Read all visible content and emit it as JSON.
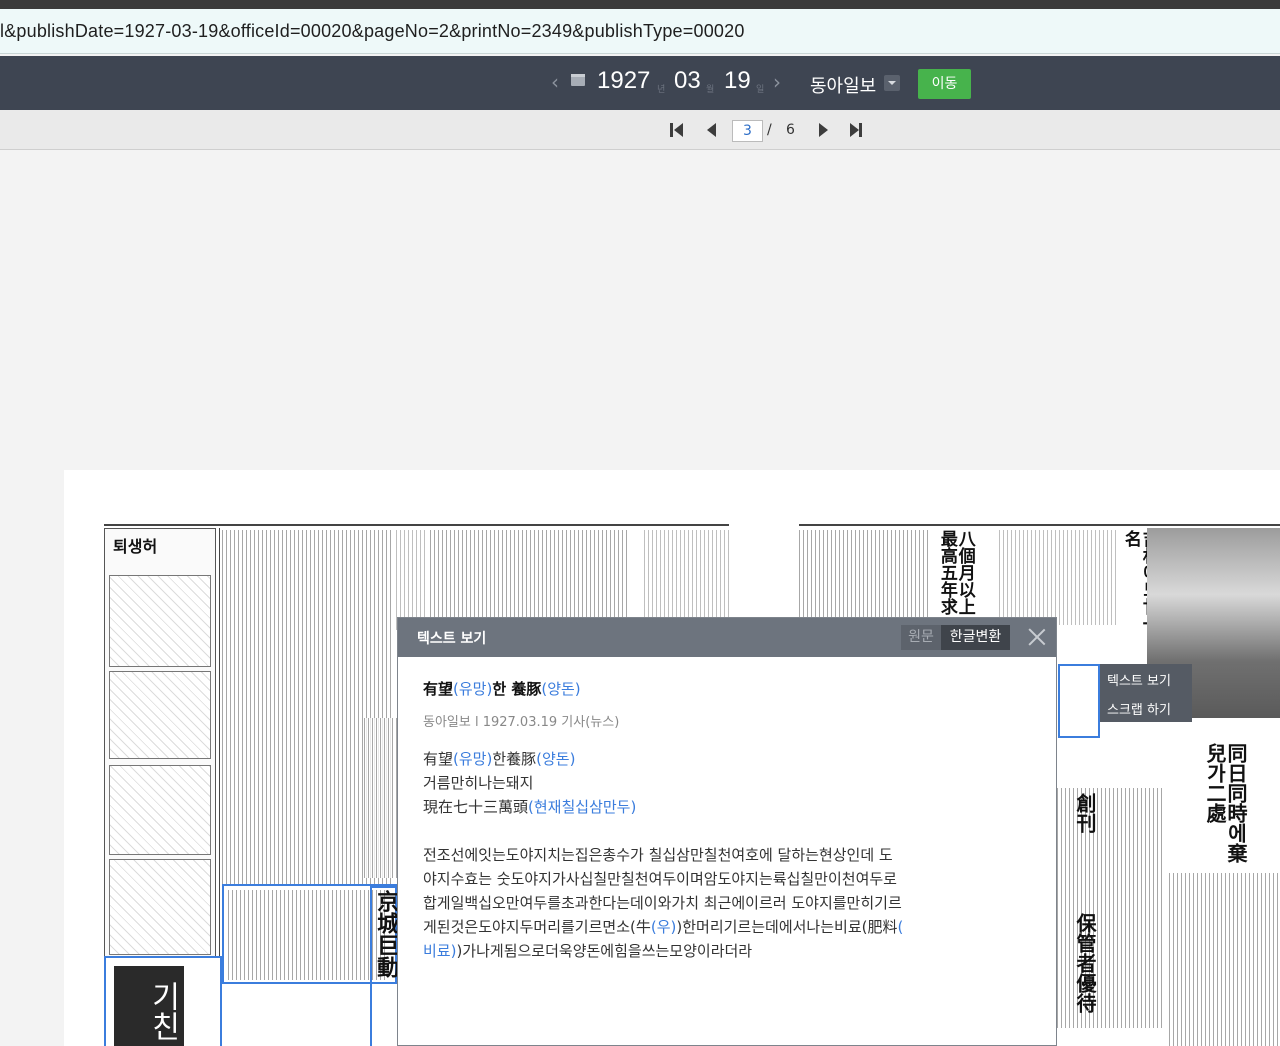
{
  "url": "l&publishDate=1927-03-19&officeId=00020&pageNo=2&printNo=2349&publishType=00020",
  "date_nav": {
    "year": "1927",
    "year_unit": "년",
    "month": "03",
    "month_unit": "월",
    "day": "19",
    "day_unit": "일",
    "newspaper": "동아일보",
    "go_label": "이동"
  },
  "page_nav": {
    "current": "3",
    "separator": "/",
    "total": "6"
  },
  "context_menu": {
    "text_view": "텍스트 보기",
    "scrap": "스크랩 하기"
  },
  "popup": {
    "header_title": "텍스트 보기",
    "tab_original": "원문",
    "tab_korean": "한글변환",
    "article_title": {
      "a": "有望",
      "a_read": "(유망)",
      "b": "한 養豚",
      "b_read": "(양돈)"
    },
    "meta": "동아일보 l 1927.03.19 기사(뉴스)",
    "lines": {
      "l1_a": "有望",
      "l1_a_read": "(유망)",
      "l1_b": "한養豚",
      "l1_b_read": "(양돈)",
      "l2": "거름만히나는돼지",
      "l3_a": "現在七十三萬頭",
      "l3_a_read": "(현재칠십삼만두)"
    },
    "paragraph": {
      "p1": " 전조선에잇는도야지치는집은총수가 칠십삼만칠천여호에 달하는현상인데 도",
      "p2": "야지수효는 숫도야지가사십칠만칠천여두이며암도야지는륙십칠만이천여두로",
      "p3": "합게일백십오만여두를초과한다는데이와가치 최근에이르러 도야지를만히기르",
      "p4_a": "게된것은도야지두머리를기르면소(牛",
      "p4_a_read": "(우)",
      "p4_b": ")한머리기르는데에서나는비료(肥料",
      "p4_b_read": "(",
      "p5_a_read": "비료)",
      "p5_b": ")가나게됨으로더욱양돈에힘을쓰는모양이라더라"
    }
  },
  "newspaper_images": {
    "left_heading": "퇴생허",
    "right_headline_1": "吉林에도廿一名",
    "right_headline_2": "八個月以上最高五年求",
    "right_headline_3": "同日同時에棄兒가二處",
    "right_headline_4": "創刊",
    "right_headline_5": "保管者優待",
    "left_block": "京城巨動",
    "left_dark_block": "기친"
  }
}
